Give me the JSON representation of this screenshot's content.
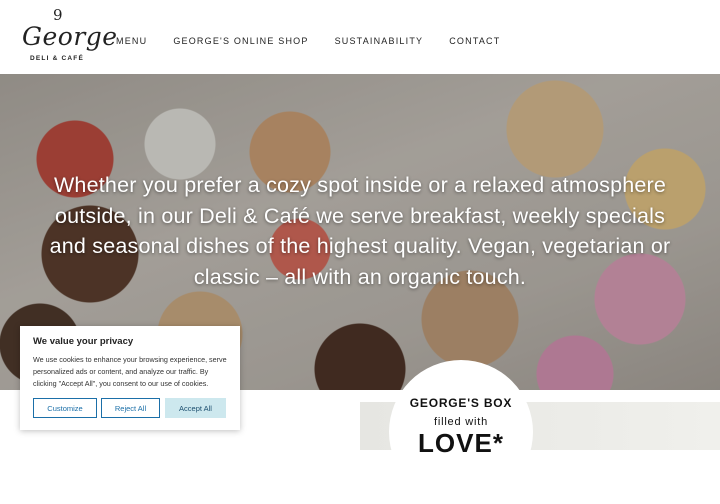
{
  "logo": {
    "mark": "9",
    "name": "George",
    "sub": "DELI & CAFÉ"
  },
  "nav": {
    "items": [
      "MENU",
      "GEORGE'S ONLINE SHOP",
      "SUSTAINABILITY",
      "CONTACT"
    ]
  },
  "hero": {
    "text": "Whether you prefer a cozy spot inside or a relaxed atmosphere outside, in our Deli & Café we serve breakfast, weekly specials and seasonal dishes of the highest quality. Vegan, vegetarian or classic – all with an organic touch."
  },
  "badge": {
    "line1": "GEORGE'S BOX",
    "line2": "filled with",
    "line3": "LOVE*"
  },
  "cookie": {
    "title": "We value your privacy",
    "description": "We use cookies to enhance your browsing experience, serve personalized ads or content, and analyze our traffic. By clicking \"Accept All\", you consent to our use of cookies.",
    "customize": "Customize",
    "reject": "Reject All",
    "accept": "Accept All"
  }
}
